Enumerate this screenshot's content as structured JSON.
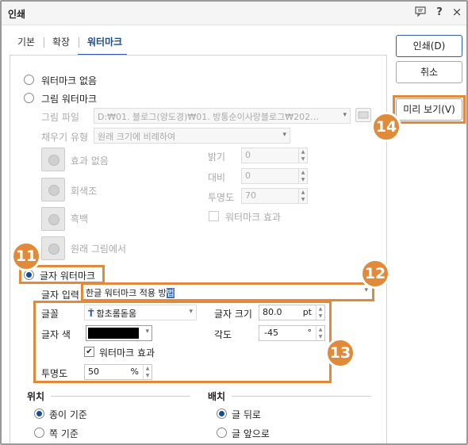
{
  "window": {
    "title": "인쇄",
    "help_icon": "?",
    "close_icon": "×"
  },
  "tabs": [
    {
      "label": "기본"
    },
    {
      "label": "확장"
    },
    {
      "label": "워터마크",
      "active": true
    }
  ],
  "buttons": {
    "print": "인쇄(D)",
    "cancel": "취소",
    "preview": "미리 보기(V)"
  },
  "watermark": {
    "none_label": "워터마크 없음",
    "image_label": "그림 워터마크",
    "image_file_label": "그림 파일",
    "image_file_value": "D:₩01. 블로그(양도경)₩01. 방통순이사랑블로그₩202…",
    "fill_type_label": "채우기 유형",
    "fill_type_value": "원래 크기에 비례하여",
    "effect_none": "효과 없음",
    "effect_gray": "회색조",
    "effect_bw": "흑백",
    "effect_original": "원래 그림에서",
    "brightness_label": "밝기",
    "brightness_value": "0",
    "contrast_label": "대비",
    "contrast_value": "0",
    "transparency_label": "투명도",
    "transparency_value": "70",
    "watermark_effect_label": "워터마크 효과",
    "text_label": "글자 워터마크",
    "text_input_label": "글자 입력",
    "text_input_value_prefix": "한글 워터마크 적용 방",
    "text_input_value_selected": "법",
    "font_label": "글꼴",
    "font_value": "함초롬돋움",
    "font_icon": "Ť",
    "size_label": "글자 크기",
    "size_value": "80.0",
    "size_unit": "pt",
    "color_label": "글자 색",
    "angle_label": "각도",
    "angle_value": "-45",
    "angle_unit": "°",
    "text_effect_label": "워터마크 효과",
    "text_transparency_label": "투명도",
    "text_transparency_value": "50",
    "text_transparency_unit": "%"
  },
  "position": {
    "title": "위치",
    "paper": "종이 기준",
    "page": "쪽 기준"
  },
  "placement": {
    "title": "배치",
    "behind": "글 뒤로",
    "front": "글 앞으로"
  },
  "annotations": {
    "b11": "11",
    "b12": "12",
    "b13": "13",
    "b14": "14"
  },
  "colors": {
    "accent": "#e08a3a",
    "primary": "#2e5fa8",
    "text_color": "#000000"
  }
}
